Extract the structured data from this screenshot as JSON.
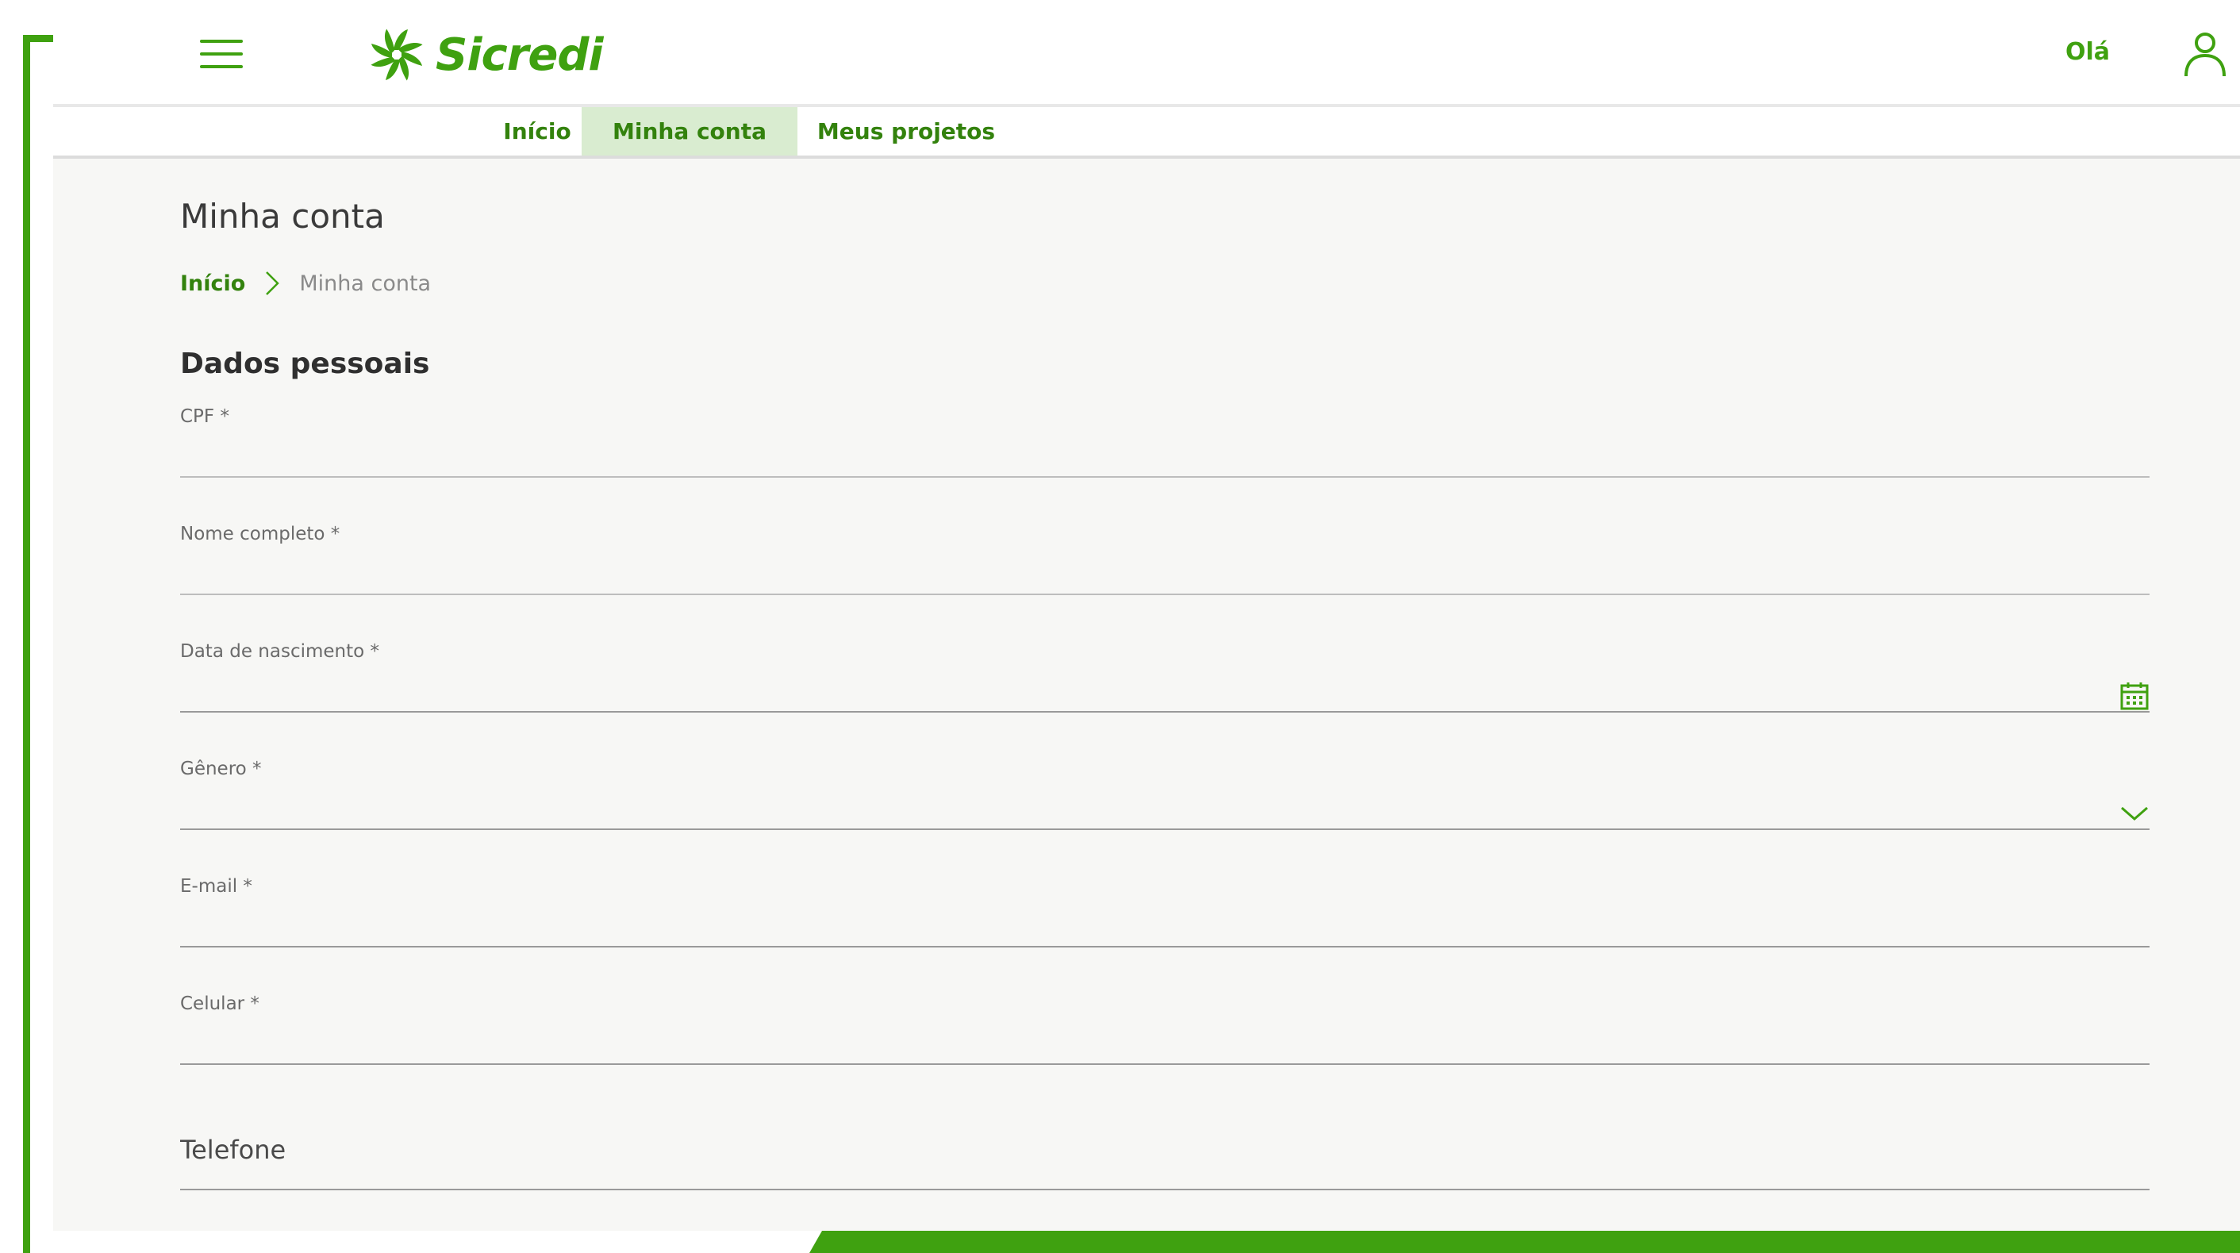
{
  "brand": {
    "name": "Sicredi",
    "color": "#3fa110",
    "tab_active_bg": "#d9ecd0"
  },
  "header": {
    "greeting": "Olá",
    "menu_icon": "hamburger-menu-icon",
    "user_icon": "user-icon"
  },
  "nav": {
    "tabs": [
      {
        "label": "Início",
        "active": false
      },
      {
        "label": "Minha conta",
        "active": true
      },
      {
        "label": "Meus projetos",
        "active": false
      }
    ]
  },
  "page": {
    "title": "Minha conta",
    "breadcrumb": [
      {
        "label": "Início",
        "link": true
      },
      {
        "label": "Minha conta",
        "link": false
      }
    ]
  },
  "form": {
    "section_title": "Dados pessoais",
    "fields": {
      "cpf": {
        "label": "CPF *",
        "value": ""
      },
      "nome": {
        "label": "Nome completo *",
        "value": ""
      },
      "nascimento": {
        "label": "Data de nascimento *",
        "value": "",
        "icon": "calendar-icon"
      },
      "genero": {
        "label": "Gênero *",
        "value": "",
        "icon": "chevron-down-icon"
      },
      "email": {
        "label": "E-mail *",
        "value": ""
      },
      "celular": {
        "label": "Celular *",
        "value": ""
      },
      "telefone": {
        "placeholder": "Telefone",
        "value": ""
      }
    }
  }
}
